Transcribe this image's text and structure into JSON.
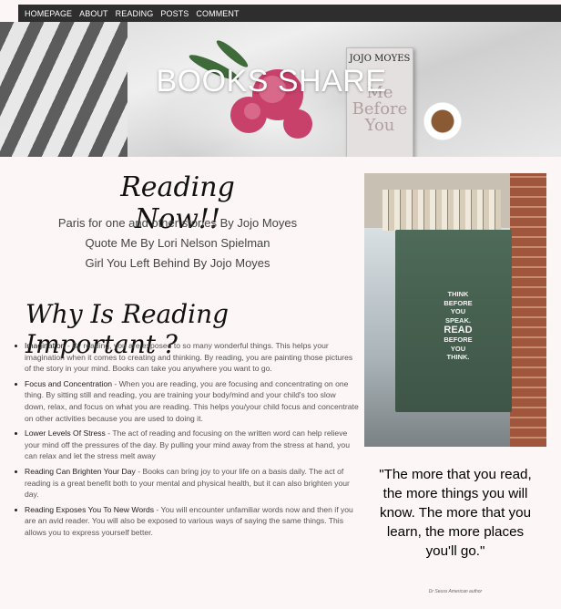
{
  "nav": {
    "items": [
      "HOMEPAGE",
      "ABOUT",
      "READING",
      "POSTS",
      "COMMENT"
    ]
  },
  "hero": {
    "title": "BOOKS SHARE",
    "book_author": "JOJO MOYES",
    "book_title": "Me Before You"
  },
  "reading_now": {
    "heading": "Reading Now!!",
    "books": [
      "Paris for one and other stories By Jojo Moyes",
      "Quote Me By Lori Nelson Spielman",
      "Girl You Left Behind By Jojo Moyes"
    ]
  },
  "why": {
    "heading": "Why Is Reading Important ?",
    "items": [
      {
        "title": "Imagination",
        "text": " - By reading, you are exposed to so many wonderful things. This helps your imagination when it comes to creating and thinking. By reading, you are painting those pictures of the story in your mind. Books can take you anywhere you want to go."
      },
      {
        "title": "Focus and Concentration",
        "text": " - When you are reading, you are focusing and concentrating on one thing. By sitting still and reading, you are training your body/mind and your child's too slow down, relax, and focus on what you are reading. This helps you/your child focus and concentrate on other activities because you are used to doing it."
      },
      {
        "title": "Lower Levels Of Stress",
        "text": " - The act of reading and focusing on the written word can help relieve your mind off the pressures of the day. By pulling your mind away from the stress at hand, you can relax and let the stress melt away"
      },
      {
        "title": "Reading Can Brighten Your Day",
        "text": " - Books can bring joy to your life on a basis daily. The act of reading is a great benefit both to your mental and physical health, but it can also brighten your day."
      },
      {
        "title": "Reading Exposes You To New Words",
        "text": " - You will encounter unfamiliar words now and then if you are an avid reader. You will also be exposed to various ways of saying the same things. This allows you to express yourself better."
      }
    ]
  },
  "photo": {
    "sign_lines": [
      "THINK",
      "BEFORE",
      "YOU",
      "SPEAK.",
      "READ",
      "BEFORE",
      "YOU",
      "THINK."
    ]
  },
  "quote": {
    "text": "\"The more that you read, the more things you will know. The more that you learn, the more places you'll go.\"",
    "attribution": "Dr Seuss American author"
  }
}
